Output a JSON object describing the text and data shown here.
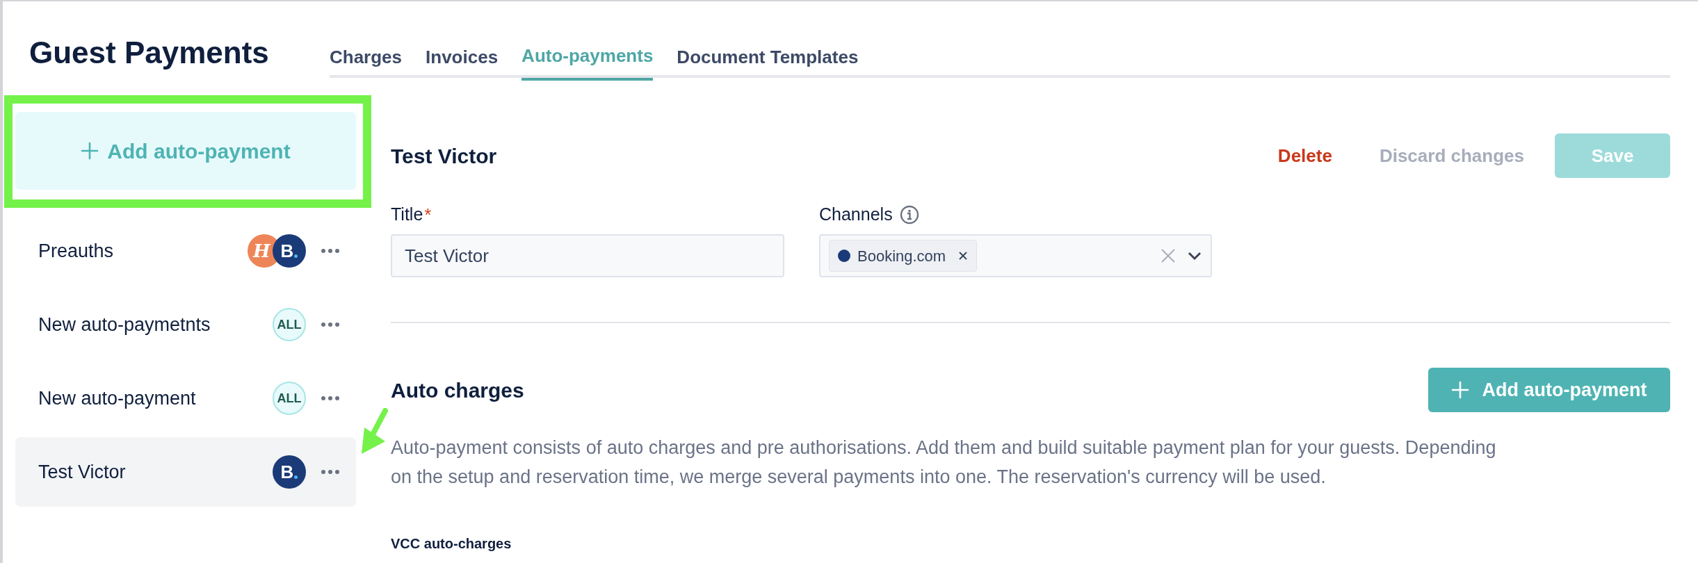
{
  "page_title": "Guest Payments",
  "tabs": [
    {
      "label": "Charges",
      "selected": false
    },
    {
      "label": "Invoices",
      "selected": false
    },
    {
      "label": "Auto-payments",
      "selected": true
    },
    {
      "label": "Document Templates",
      "selected": false
    }
  ],
  "sidebar": {
    "add_button": "Add auto-payment",
    "items": [
      {
        "name": "Preauths",
        "selected": false,
        "badges": [
          {
            "kind": "hostel",
            "text": "H"
          },
          {
            "kind": "booking",
            "text": "B"
          }
        ]
      },
      {
        "name": "New auto-paymetnts",
        "selected": false,
        "badges": [
          {
            "kind": "all",
            "text": "ALL"
          }
        ]
      },
      {
        "name": "New auto-payment",
        "selected": false,
        "badges": [
          {
            "kind": "all",
            "text": "ALL"
          }
        ]
      },
      {
        "name": "Test Victor",
        "selected": true,
        "badges": [
          {
            "kind": "booking",
            "text": "B"
          }
        ]
      }
    ]
  },
  "detail": {
    "heading": "Test Victor",
    "delete": "Delete",
    "discard": "Discard changes",
    "save": "Save",
    "save_disabled": true,
    "title_field": {
      "label": "Title",
      "required_mark": "*",
      "value": "Test Victor"
    },
    "channels_field": {
      "label": "Channels",
      "chips": [
        "Booking.com"
      ]
    }
  },
  "auto_charges": {
    "heading": "Auto charges",
    "add_button": "Add auto-payment",
    "description": "Auto-payment consists of auto charges and pre authorisations. Add them and build suitable payment plan for your guests. Depending on the setup and reservation time, we merge several payments into one. The reservation's currency will be used.",
    "subheading": "VCC auto-charges"
  }
}
